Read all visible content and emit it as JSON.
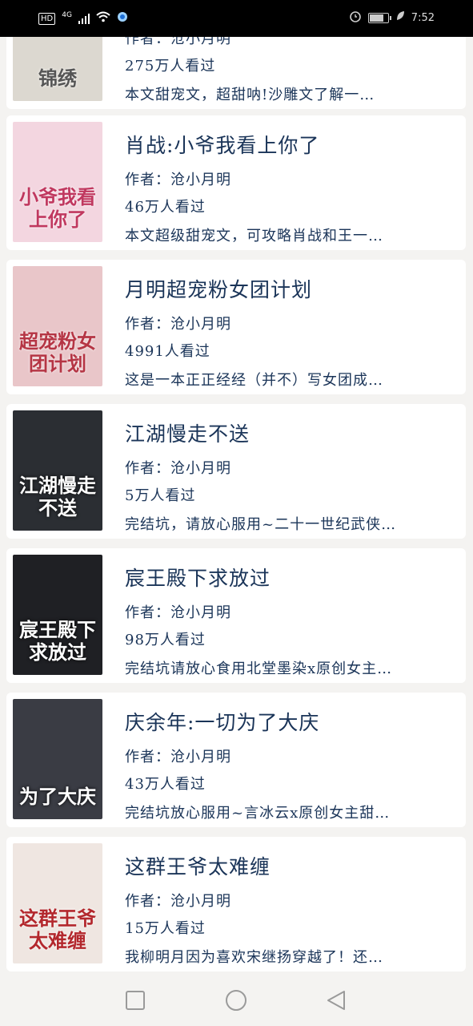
{
  "status_bar": {
    "hd": "HD",
    "network": "4G",
    "time": "7:52"
  },
  "books": [
    {
      "cover_text": "锦绣",
      "title": "",
      "author_label": "作者：沧小月明",
      "views": "275万人看过",
      "desc": "本文甜宠文，超甜呐!沙雕文了解一…",
      "cover_bg": "#dcd8d0",
      "cover_fg": "#555555",
      "dark": false
    },
    {
      "cover_text": "小爷我看上你了",
      "title": "肖战:小爷我看上你了",
      "author_label": "作者：沧小月明",
      "views": "46万人看过",
      "desc": "本文超级甜宠文，可攻略肖战和王一…",
      "cover_bg": "#f3d6e0",
      "cover_fg": "#c0385f",
      "dark": false
    },
    {
      "cover_text": "超宠粉女团计划",
      "title": "月明超宠粉女团计划",
      "author_label": "作者：沧小月明",
      "views": "4991人看过",
      "desc": "这是一本正正经经（并不）写女团成…",
      "cover_bg": "#e9c6c9",
      "cover_fg": "#b53544",
      "dark": false
    },
    {
      "cover_text": "江湖慢走不送",
      "title": "江湖慢走不送",
      "author_label": "作者：沧小月明",
      "views": "5万人看过",
      "desc": "完结坑，请放心服用~二十一世纪武侠…",
      "cover_bg": "#2b2e33",
      "cover_fg": "#ffffff",
      "dark": true
    },
    {
      "cover_text": "宸王殿下求放过",
      "title": "宸王殿下求放过",
      "author_label": "作者：沧小月明",
      "views": "98万人看过",
      "desc": "完结坑请放心食用北堂墨染x原创女主…",
      "cover_bg": "#1f2024",
      "cover_fg": "#ffffff",
      "dark": true
    },
    {
      "cover_text": "为了大庆",
      "title": "庆余年:一切为了大庆",
      "author_label": "作者：沧小月明",
      "views": "43万人看过",
      "desc": "完结坑放心服用~言冰云x原创女主甜…",
      "cover_bg": "#3a3c44",
      "cover_fg": "#ffffff",
      "dark": true
    },
    {
      "cover_text": "这群王爷太难缠",
      "title": "这群王爷太难缠",
      "author_label": "作者：沧小月明",
      "views": "15万人看过",
      "desc": "我柳明月因为喜欢宋继扬穿越了！还…",
      "cover_bg": "#efe6e1",
      "cover_fg": "#b3282d",
      "dark": false
    }
  ],
  "nav": {
    "recents": "square-icon",
    "home": "circle-icon",
    "back": "triangle-back-icon"
  }
}
